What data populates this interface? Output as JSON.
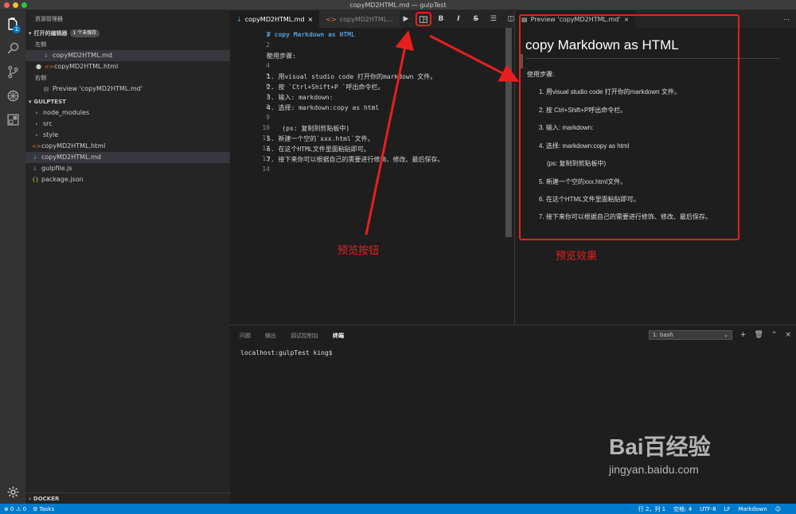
{
  "window": {
    "title": "copyMD2HTML.md — gulpTest"
  },
  "activity": {
    "scm_badge": "1"
  },
  "sidebar": {
    "title": "资源管理器",
    "open_editors": {
      "label": "打开的编辑器",
      "unsaved": "1 个未保存"
    },
    "groups": {
      "left": "左侧",
      "right": "右侧"
    },
    "open_files_left": [
      "copyMD2HTML.md",
      "copyMD2HTML.html"
    ],
    "open_files_right": [
      "Preview 'copyMD2HTML.md'"
    ],
    "project": "GULPTEST",
    "tree": [
      {
        "name": "node_modules",
        "kind": "folder"
      },
      {
        "name": "src",
        "kind": "folder"
      },
      {
        "name": "style",
        "kind": "folder"
      },
      {
        "name": "copyMD2HTML.html",
        "kind": "html"
      },
      {
        "name": "copyMD2HTML.md",
        "kind": "md"
      },
      {
        "name": "gulpfile.js",
        "kind": "js"
      },
      {
        "name": "package.json",
        "kind": "json"
      }
    ],
    "docker": "DOCKER"
  },
  "editor": {
    "tabs": [
      {
        "label": "copyMD2HTML.md",
        "active": true
      },
      {
        "label": "copyMD2HTML..."
      }
    ],
    "toolbar": [
      "run",
      "preview",
      "B",
      "I",
      "S",
      "list",
      "split",
      "more"
    ],
    "line_numbers": [
      "1",
      "2",
      "3",
      "4",
      "5",
      "6",
      "7",
      "8",
      "9",
      "10",
      "11",
      "12",
      "13",
      "14"
    ],
    "lines": [
      "# copy Markdown as HTML",
      "",
      "使用步骤:",
      "",
      "1. 用visual studio code 打开你的markdown 文件。",
      "2. 按 `Ctrl+Shift+P `呼出命令栏。",
      "3. 输入: markdown:",
      "4. 选择: markdown:copy as html",
      "",
      "    (ps: 复制到剪贴板中)",
      "5. 新建一个空的`xxx.html`文件。",
      "6. 在这个HTML文件里面粘贴即可。",
      "7. 接下来你可以根据自己的需要进行修饰、修改、最后保存。",
      ""
    ]
  },
  "preview": {
    "tab": "Preview 'copyMD2HTML.md'",
    "title": "copy Markdown as HTML",
    "intro": "使用步骤:",
    "items": [
      "1. 用visual studio code 打开你的markdown 文件。",
      "2. 按 Ctrl+Shift+P呼出命令栏。",
      "3. 输入: markdown:",
      "4. 选择: markdown:copy as html",
      "(ps: 复制到剪贴板中)",
      "5. 新建一个空的xxx.html文件。",
      "6. 在这个HTML文件里面粘贴即可。",
      "7. 接下来你可以根据自己的需要进行修饰、修改、最后保存。"
    ]
  },
  "annotations": {
    "preview_button": "预览按钮",
    "preview_effect": "预览效果"
  },
  "panel": {
    "tabs": [
      "问题",
      "输出",
      "调试控制台",
      "终端"
    ],
    "active_tab": "终端",
    "terminal_select": "1: bash",
    "terminal_line": "localhost:gulpTest king$"
  },
  "statusbar": {
    "errors": "0",
    "warnings": "0",
    "tasks": "Tasks",
    "position": "行 2，列 1",
    "spaces": "空格: 4",
    "encoding": "UTF-8",
    "eol": "LF",
    "language": "Markdown"
  },
  "watermark": {
    "brand": "Bai百经验",
    "url": "jingyan.baidu.com"
  }
}
